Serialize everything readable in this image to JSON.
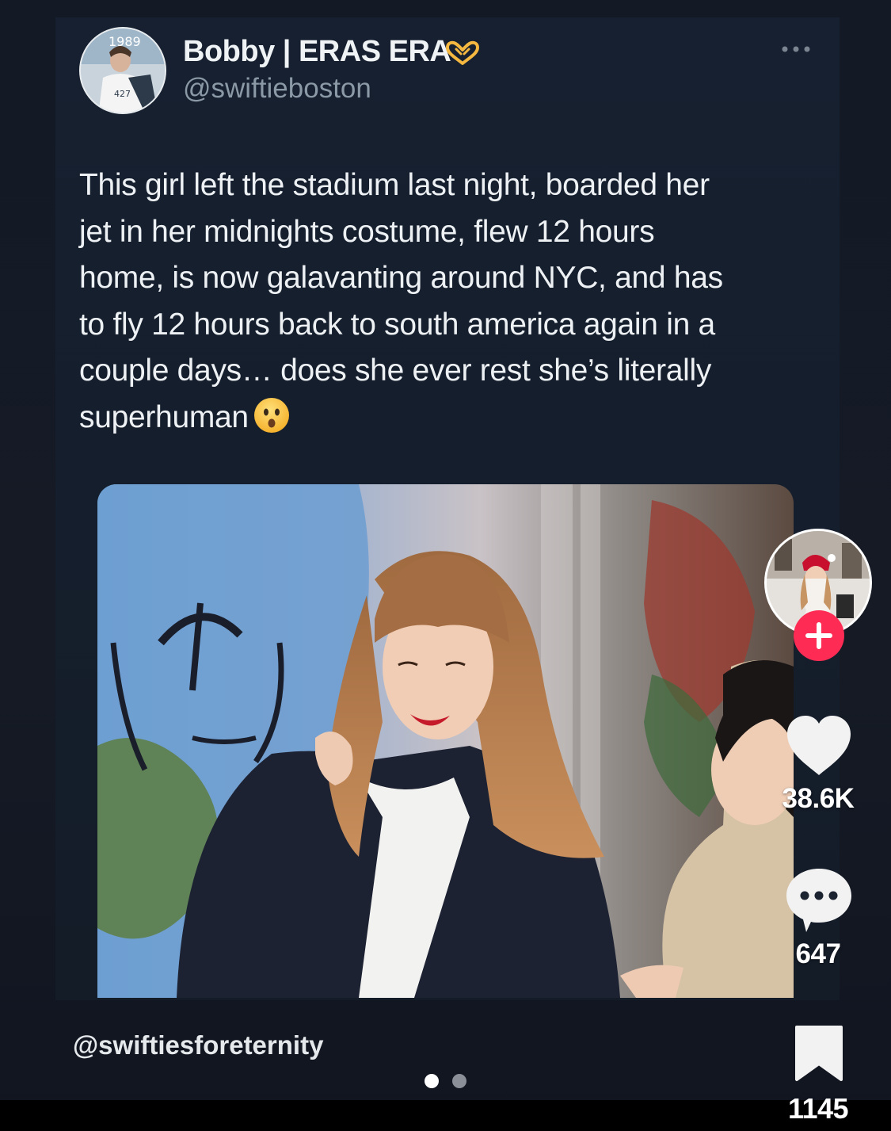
{
  "tweet": {
    "display_name": "Bobby | ERAS ERA",
    "name_emoji": "heart-hands-icon",
    "handle": "@swiftieboston",
    "lines": [
      "This girl left the stadium last night, boarded her",
      "jet in her midnights costume, flew 12 hours",
      "home, is now galavanting around NYC, and has",
      "to fly 12 hours back to south america again in a",
      "couple days… does she ever rest she’s literally",
      "superhuman"
    ],
    "end_emoji": "astonished-face-icon",
    "avatar_badge": "1989",
    "more_icon": "more-horizontal-icon"
  },
  "media": {
    "description_icon": "photo"
  },
  "video": {
    "watermark": "@swiftiesforeternity",
    "carousel_total": 2,
    "carousel_active": 1
  },
  "rail": {
    "follow_icon": "plus-icon",
    "likes": "38.6K",
    "comments": "647",
    "saves": "1145"
  },
  "colors": {
    "background": "#151a25",
    "text": "#eef1f4",
    "handle": "#8b98a5",
    "follow": "#fe2c55",
    "heart_hands": "#f4b740"
  }
}
